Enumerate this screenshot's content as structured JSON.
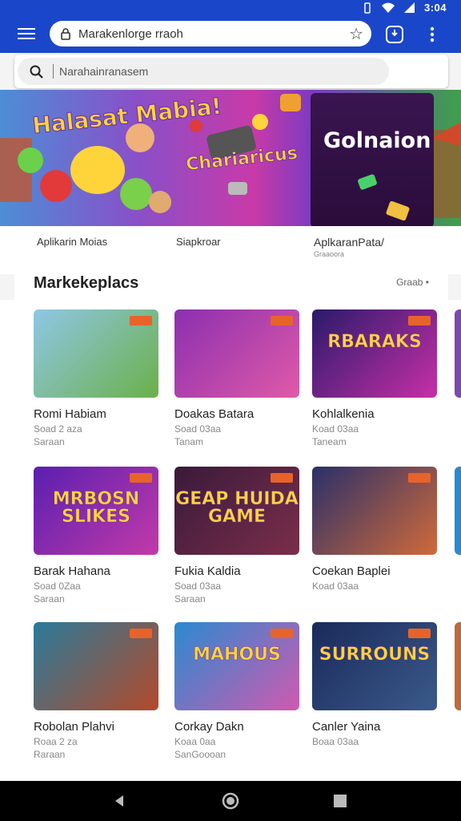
{
  "status_bar": {
    "time": "3:04"
  },
  "app_bar": {
    "url": "Marakenlorge rraoh"
  },
  "search": {
    "placeholder": "Narahainranasem"
  },
  "banner": {
    "left_title": "Halasat Mabia!",
    "mid_title": "Chariaricus",
    "card_title": "Golnaion"
  },
  "labels": [
    {
      "label": "Aplikarin Moias",
      "sub": ""
    },
    {
      "label": "Siapkroar",
      "sub": ""
    },
    {
      "label": "AplkaranPata/",
      "sub": "Graaoora"
    }
  ],
  "section": {
    "title": "Markekeplacs",
    "more": "Graab"
  },
  "apps": [
    {
      "name": "Romi Habiam",
      "sub1": "Soad 2 aza",
      "sub2": "Saraan",
      "thumb_text": "",
      "colors": [
        "#8fc7e6",
        "#6bb04a"
      ]
    },
    {
      "name": "Doakas Batara",
      "sub1": "Soad 03aa",
      "sub2": "Tanam",
      "thumb_text": "",
      "colors": [
        "#8b2fb0",
        "#e05aa8"
      ]
    },
    {
      "name": "Kohlalkenia",
      "sub1": "Koad 03aa",
      "sub2": "Taneam",
      "thumb_text": "RBARAKS",
      "colors": [
        "#2a1a6a",
        "#c72fa8"
      ]
    },
    {
      "name": "Barak Hahana",
      "sub1": "Soad 0Zaa",
      "sub2": "Saraan",
      "thumb_text": "MRBOSN SLIKES",
      "colors": [
        "#5a1fb0",
        "#c23aa8"
      ]
    },
    {
      "name": "Fukia Kaldia",
      "sub1": "Soad 03aa",
      "sub2": "Saraan",
      "thumb_text": "GEAP HUIDA GAME",
      "colors": [
        "#3a1a3a",
        "#7a2e4a"
      ]
    },
    {
      "name": "Coekan Baplei",
      "sub1": "Koad 03aa",
      "sub2": "",
      "thumb_text": "",
      "colors": [
        "#2a2f6a",
        "#d06a3a"
      ]
    },
    {
      "name": "Robolan Plahvi",
      "sub1": "Roaa 2 za",
      "sub2": "Raraan",
      "thumb_text": "",
      "colors": [
        "#2a7a9a",
        "#b34a2a"
      ]
    },
    {
      "name": "Corkay Dakn",
      "sub1": "Koaa 0aa",
      "sub2": "SanGoooan",
      "thumb_text": "MAHOUS",
      "colors": [
        "#2a8ad0",
        "#d05ab0"
      ]
    },
    {
      "name": "Canler Yaina",
      "sub1": "Boaa 03aa",
      "sub2": "",
      "thumb_text": "SURROUNS",
      "colors": [
        "#1a2a5a",
        "#3a5a8a"
      ]
    }
  ]
}
